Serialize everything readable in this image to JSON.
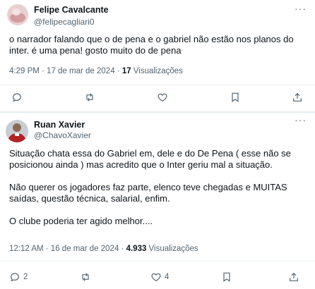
{
  "tweet1": {
    "display_name": "Felipe Cavalcante",
    "handle": "@felipecagliari0",
    "text_line1": "o narrador falando que o de pena e o gabriel não estão nos planos do",
    "text_line2": "inter. é uma pena! gosto muito do de pena",
    "time": "4:29 PM · 17 de mar de 2024 · ",
    "views_count": "17",
    "views_label": " Visualizações"
  },
  "tweet2": {
    "display_name": "Ruan Xavier",
    "handle": "@ChavoXavier",
    "text_p1_line1": "Situação chata essa do Gabriel em, dele e do De Pena ( esse não se",
    "text_p1_line2": "posicionou ainda ) mas acredito que o Inter geriu mal a situação.",
    "text_p2_line1": "Não querer os jogadores faz parte, elenco teve chegadas e MUITAS",
    "text_p2_line2": "saídas, questão técnica, salarial, enfim.",
    "text_p3_line1": "O clube poderia ter agido melhor....",
    "time": "12:12 AM · 16 de mar de 2024 · ",
    "views_count": "4.933",
    "views_label": " Visualizações",
    "reply_count": "2",
    "like_count": "4"
  },
  "icons": {
    "reply": "reply-icon",
    "retweet": "retweet-icon",
    "like": "heart-icon",
    "bookmark": "bookmark-icon",
    "share": "share-icon",
    "more": "more-icon"
  },
  "colors": {
    "text": "#0f1419",
    "secondary": "#536471",
    "divider": "#eff3f4"
  }
}
